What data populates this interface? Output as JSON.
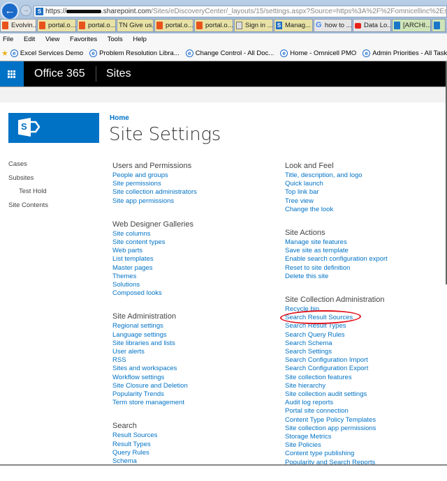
{
  "browser": {
    "url_prefix": "https://",
    "url_domain": ".sharepoint.com",
    "url_path": "/Sites/eDiscoveryCenter/_layouts/15/settings.aspx?Source=https%3A%2F%2Fomnicellinc%2Esharepoint%2Ecom%",
    "tabs": [
      {
        "label": "Evolvin...",
        "icon": "office-icon"
      },
      {
        "label": "portal.o...",
        "icon": "office-icon"
      },
      {
        "label": "portal.o...",
        "icon": "office-icon"
      },
      {
        "label": "TN Give us...",
        "icon": ""
      },
      {
        "label": "portal.o...",
        "icon": "office-icon"
      },
      {
        "label": "portal.o...",
        "icon": "office-icon"
      },
      {
        "label": "Sign in ...",
        "icon": "sign-in-icon"
      },
      {
        "label": "Manag...",
        "icon": "sharepoint-icon"
      },
      {
        "label": "how to ...",
        "icon": "google-icon"
      },
      {
        "label": "Data Lo...",
        "icon": "youtube-icon"
      },
      {
        "label": "[ARCHI...",
        "icon": "office-icon"
      },
      {
        "label": "",
        "icon": "office-icon"
      }
    ],
    "menu": [
      "File",
      "Edit",
      "View",
      "Favorites",
      "Tools",
      "Help"
    ],
    "favorites": [
      "Excel Services Demo",
      "Problem Resolution Libra...",
      "Change Control - All Doc...",
      "Home - Omnicell PMO",
      "Admin Priorities - All Tasks"
    ]
  },
  "suitebar": {
    "title": "Office 365",
    "app": "Sites"
  },
  "page": {
    "breadcrumb": "Home",
    "title": "Site Settings"
  },
  "quicklaunch": [
    {
      "label": "Cases"
    },
    {
      "label": "Subsites"
    },
    {
      "label": "Test Hold"
    },
    {
      "label": "Site Contents"
    }
  ],
  "sections_left": [
    {
      "title": "Users and Permissions",
      "links": [
        "People and groups",
        "Site permissions",
        "Site collection administrators",
        "Site app permissions"
      ]
    },
    {
      "title": "Web Designer Galleries",
      "links": [
        "Site columns",
        "Site content types",
        "Web parts",
        "List templates",
        "Master pages",
        "Themes",
        "Solutions",
        "Composed looks"
      ]
    },
    {
      "title": "Site Administration",
      "links": [
        "Regional settings",
        "Language settings",
        "Site libraries and lists",
        "User alerts",
        "RSS",
        "Sites and workspaces",
        "Workflow settings",
        "Site Closure and Deletion",
        "Popularity Trends",
        "Term store management"
      ]
    },
    {
      "title": "Search",
      "links": [
        "Result Sources",
        "Result Types",
        "Query Rules",
        "Schema"
      ]
    }
  ],
  "sections_right": [
    {
      "title": "Look and Feel",
      "links": [
        "Title, description, and logo",
        "Quick launch",
        "Top link bar",
        "Tree view",
        "Change the look"
      ]
    },
    {
      "title": "Site Actions",
      "links": [
        "Manage site features",
        "Save site as template",
        "Enable search configuration export",
        "Reset to site definition",
        "Delete this site"
      ]
    },
    {
      "title": "Site Collection Administration",
      "links": [
        "Recycle bin",
        "Search Result Sources",
        "Search Result Types",
        "Search Query Rules",
        "Search Schema",
        "Search Settings",
        "Search Configuration Import",
        "Search Configuration Export",
        "Site collection features",
        "Site hierarchy",
        "Site collection audit settings",
        "Audit log reports",
        "Portal site connection",
        "Content Type Policy Templates",
        "Site collection app permissions",
        "Storage Metrics",
        "Site Policies",
        "Content type publishing",
        "Popularity and Search Reports"
      ]
    }
  ],
  "annotation": {
    "highlighted_link": "Search Result Sources",
    "color": "#e0141e"
  },
  "colors": {
    "brand": "#0072c6",
    "suitebar": "#000000"
  }
}
